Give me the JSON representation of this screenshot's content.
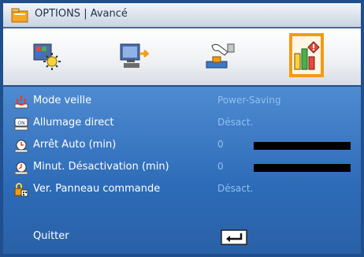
{
  "window": {
    "title": "OPTIONS | Avancé",
    "title_icon": "folder-options-icon"
  },
  "tabs": [
    {
      "icon": "image-settings-icon",
      "selected": false
    },
    {
      "icon": "display-settings-icon",
      "selected": false
    },
    {
      "icon": "setup-hand-icon",
      "selected": false
    },
    {
      "icon": "options-advanced-icon",
      "selected": true
    }
  ],
  "menu": {
    "items": [
      {
        "icon": "standby-power-icon",
        "label": "Mode veille",
        "value": "Power-Saving"
      },
      {
        "icon": "direct-power-on-icon",
        "label": "Allumage direct",
        "value": "Désact."
      },
      {
        "icon": "auto-off-timer-icon",
        "label": "Arrêt Auto (min)",
        "value": "0",
        "level": 0
      },
      {
        "icon": "sleep-timer-icon",
        "label": "Minut. Désactivation (min)",
        "value": "0",
        "level": 0
      },
      {
        "icon": "keypad-lock-icon",
        "label": "Ver. Panneau commande",
        "value": "Désact."
      }
    ],
    "exit": {
      "label": "Quitter",
      "icon": "enter-return-icon"
    }
  },
  "colors": {
    "frame": "#1f4f8c",
    "panel": "#2d6bb8",
    "value_text": "#8fc0f2",
    "selection": "#f39b12"
  }
}
